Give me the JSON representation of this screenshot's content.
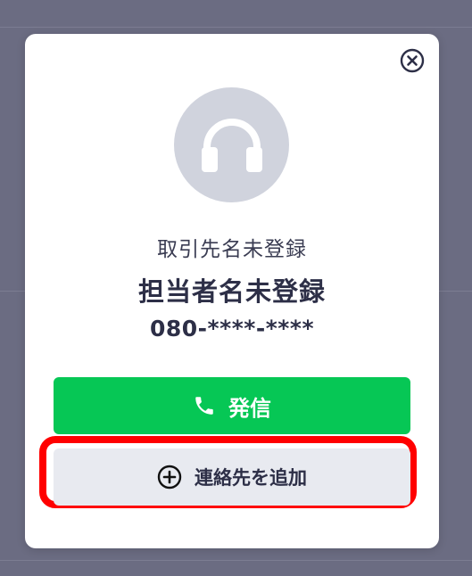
{
  "modal": {
    "company_name": "取引先名未登録",
    "contact_name": "担当者名未登録",
    "phone_number": "080-****-****",
    "call_button_label": "発信",
    "add_contact_button_label": "連絡先を追加",
    "icons": {
      "close": "close-icon",
      "avatar": "headphones-icon",
      "call": "phone-icon",
      "add": "plus-circle-icon"
    }
  },
  "colors": {
    "overlay": "#6b6c82",
    "avatar_bg": "#d0d3dd",
    "call_button": "#06c755",
    "add_button": "#e8eaf0",
    "highlight": "#ff0000",
    "text_primary": "#2d2f47"
  }
}
